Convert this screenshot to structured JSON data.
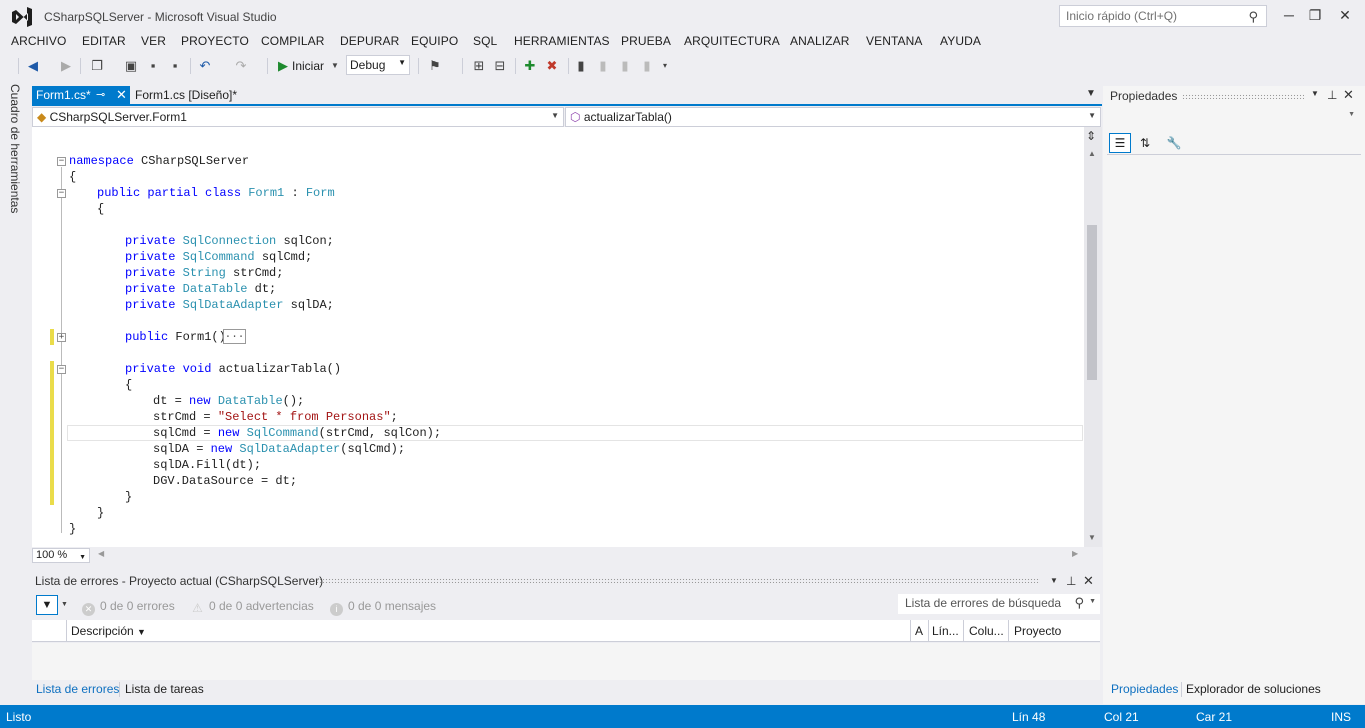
{
  "window": {
    "title": "CSharpSQLServer - Microsoft Visual Studio",
    "quick_launch_placeholder": "Inicio rápido (Ctrl+Q)",
    "minimize": "─",
    "restore": "❐",
    "close": "✕"
  },
  "menu": [
    "ARCHIVO",
    "EDITAR",
    "VER",
    "PROYECTO",
    "COMPILAR",
    "DEPURAR",
    "EQUIPO",
    "SQL",
    "HERRAMIENTAS",
    "PRUEBA",
    "ARQUITECTURA",
    "ANALIZAR",
    "VENTANA",
    "AYUDA"
  ],
  "toolbar": {
    "start_label": "Iniciar",
    "config_value": "Debug"
  },
  "toolbox": {
    "label": "Cuadro de herramientas"
  },
  "tabs": {
    "active": "Form1.cs*",
    "inactive": "Form1.cs [Diseño]*"
  },
  "navbar": {
    "type_selector": "CSharpSQLServer.Form1",
    "member_selector": "actualizarTabla()"
  },
  "code": {
    "line_namespace_kw": "namespace",
    "line_namespace_name": " CSharpSQLServer",
    "brace_open": "{",
    "brace_close": "}",
    "class_kw": "public partial class",
    "class_name": "Form1",
    "class_sep": " : ",
    "class_base": "Form",
    "private": "private",
    "field1_type": "SqlConnection",
    "field1_name": " sqlCon;",
    "field2_type": "SqlCommand",
    "field2_name": " sqlCmd;",
    "field3_type": "String",
    "field3_name": " strCmd;",
    "field4_type": "DataTable",
    "field4_name": " dt;",
    "field5_type": "SqlDataAdapter",
    "field5_name": " sqlDA;",
    "ctor_kw": "public",
    "ctor_name": " Form1()",
    "ctor_collapsed": "...",
    "method_kw": "private void",
    "method_name": " actualizarTabla()",
    "s1_a": "dt = ",
    "new": "new",
    "s1_type": "DataTable",
    "s1_b": "();",
    "s2_a": "strCmd = ",
    "s2_str": "\"Select * from Personas\"",
    "s2_b": ";",
    "s3_a": "sqlCmd = ",
    "s3_type": "SqlCommand",
    "s3_b": "(strCmd, sqlCon);",
    "s4_a": "sqlDA = ",
    "s4_type": "SqlDataAdapter",
    "s4_b": "(sqlCmd);",
    "s5": "sqlDA.Fill(dt);",
    "s6": "DGV.DataSource = dt;"
  },
  "editor": {
    "zoom": "100 %"
  },
  "properties": {
    "title": "Propiedades"
  },
  "error_list": {
    "title": "Lista de errores - Proyecto actual (CSharpSQLServer)",
    "errors": "0 de 0 errores",
    "warnings": "0 de 0 advertencias",
    "messages": "0 de 0 mensajes",
    "search_placeholder": "Lista de errores de búsqueda",
    "columns": [
      "Descripción",
      "A",
      "Lín...",
      "Colu...",
      "Proyecto"
    ]
  },
  "bottom_tabs": {
    "left": [
      "Lista de errores",
      "Lista de tareas"
    ],
    "right": [
      "Propiedades",
      "Explorador de soluciones"
    ]
  },
  "status": {
    "ready": "Listo",
    "line": "Lín 48",
    "col": "Col 21",
    "char": "Car 21",
    "mode": "INS"
  },
  "colors": {
    "accent": "#007acc",
    "keyword": "#0000ff",
    "type": "#2b91af",
    "string": "#a31515"
  }
}
